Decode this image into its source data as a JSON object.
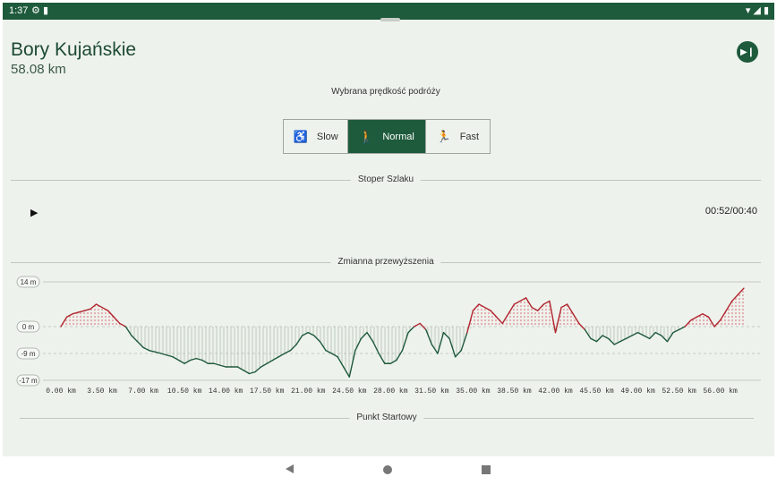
{
  "status": {
    "time": "1:37"
  },
  "trail": {
    "name": "Bory Kujańskie",
    "distance": "58.08 km"
  },
  "speed": {
    "label": "Wybrana prędkość podróży",
    "options": [
      {
        "label": "Slow",
        "icon": "walker-with-cane-icon"
      },
      {
        "label": "Normal",
        "icon": "hiker-icon"
      },
      {
        "label": "Fast",
        "icon": "runner-icon"
      }
    ],
    "selected": "Normal"
  },
  "stopwatch": {
    "section_label": "Stoper Szlaku",
    "timer": "00:52/00:40"
  },
  "elevation": {
    "section_label": "Zmianna przewyższenia"
  },
  "start": {
    "section_label": "Punkt Startowy"
  },
  "chart_data": {
    "type": "line",
    "title": "Zmianna przewyższenia",
    "y_tick_labels": [
      "14 m",
      "0 m",
      "-9 m",
      "-17 m"
    ],
    "y_ticks": [
      14,
      0,
      -9,
      -17
    ],
    "ylim": [
      -17,
      14
    ],
    "x_tick_labels": [
      "0.00 km",
      "3.50 km",
      "7.00 km",
      "10.50 km",
      "14.00 km",
      "17.50 km",
      "21.00 km",
      "24.50 km",
      "28.00 km",
      "31.50 km",
      "35.00 km",
      "38.50 km",
      "42.00 km",
      "45.50 km",
      "49.00 km",
      "52.50 km",
      "56.00 km"
    ],
    "xlim": [
      0,
      58.08
    ],
    "colors": {
      "above": "#b0262f",
      "below": "#1e5a3c"
    },
    "x": [
      0,
      0.5,
      1,
      1.5,
      2,
      2.5,
      3,
      3.5,
      4,
      4.5,
      5,
      5.5,
      6,
      6.5,
      7,
      7.5,
      8,
      8.5,
      9,
      9.5,
      10,
      10.5,
      11,
      11.5,
      12,
      12.5,
      13,
      13.5,
      14,
      14.5,
      15,
      15.5,
      16,
      16.5,
      17,
      17.5,
      18,
      18.5,
      19,
      19.5,
      20,
      20.5,
      21,
      21.5,
      22,
      22.5,
      23,
      23.5,
      24,
      24.5,
      25,
      25.5,
      26,
      26.5,
      27,
      27.5,
      28,
      28.5,
      29,
      29.5,
      30,
      30.5,
      31,
      31.5,
      32,
      32.5,
      33,
      33.5,
      34,
      34.5,
      35,
      35.5,
      36,
      36.5,
      37,
      37.5,
      38,
      38.5,
      39,
      39.5,
      40,
      40.5,
      41,
      41.5,
      42,
      42.5,
      43,
      43.5,
      44,
      44.5,
      45,
      45.5,
      46,
      46.5,
      47,
      47.5,
      48,
      48.5,
      49,
      49.5,
      50,
      50.5,
      51,
      51.5,
      52,
      52.5,
      53,
      53.5,
      54,
      54.5,
      55,
      55.5,
      56,
      56.5,
      57,
      57.5,
      58
    ],
    "y": [
      0,
      3,
      4,
      4.5,
      5,
      5.5,
      7,
      6,
      5,
      3,
      1,
      0,
      -3,
      -5,
      -7,
      -8,
      -8.5,
      -9,
      -9.5,
      -10,
      -11,
      -12,
      -11,
      -10.5,
      -11,
      -12,
      -12,
      -12.5,
      -13,
      -13,
      -13,
      -14,
      -15,
      -14.5,
      -13,
      -12,
      -11,
      -10,
      -9,
      -8,
      -6,
      -3,
      -2,
      -3,
      -5,
      -8,
      -9,
      -10,
      -13,
      -16,
      -8,
      -4,
      -2,
      -5,
      -9,
      -12,
      -12,
      -11,
      -8,
      -2,
      0,
      1,
      -1,
      -6,
      -9,
      -2,
      -4,
      -10,
      -8,
      -2,
      5,
      7,
      6,
      5,
      3,
      1,
      4,
      7,
      8,
      9,
      6,
      5,
      7,
      8,
      -2,
      6,
      7,
      4,
      1,
      -1,
      -4,
      -5,
      -3,
      -4,
      -6,
      -5,
      -4,
      -3,
      -2,
      -3,
      -4,
      -2,
      -3,
      -5,
      -2,
      -1,
      0,
      2,
      3,
      4,
      3,
      0,
      2,
      5,
      8,
      10,
      12,
      14,
      12
    ]
  }
}
